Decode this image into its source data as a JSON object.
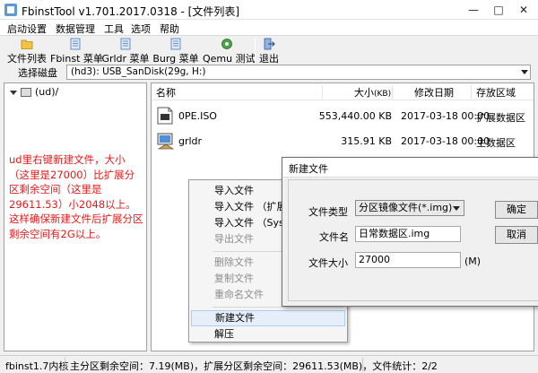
{
  "window": {
    "title": "FbinstTool v1.701.2017.0318 - [文件列表]",
    "minimize": "—",
    "maximize": "□",
    "close": "✕"
  },
  "menubar": [
    "启动设置",
    "数据管理",
    "工具",
    "选项",
    "帮助"
  ],
  "toolbar": [
    {
      "label": "文件列表",
      "icon": "folder-icon"
    },
    {
      "label": "Fbinst 菜单",
      "icon": "menu-doc-icon"
    },
    {
      "label": "Grldr 菜单",
      "icon": "menu-doc-icon"
    },
    {
      "label": "Burg 菜单",
      "icon": "menu-doc-icon"
    },
    {
      "label": "Qemu 测试",
      "icon": "qemu-icon"
    },
    {
      "label": "退出",
      "icon": "exit-icon"
    }
  ],
  "disk": {
    "label": "选择磁盘",
    "value": "(hd3): USB_SanDisk(29g, H:)"
  },
  "tree": {
    "item": "(ud)/"
  },
  "note": "ud里右键新建文件，大小（这里是27000）比扩展分区剩余空间（这里是29611.53）小2048以上。这样确保新建文件后扩展分区剩余空间有2G以上。",
  "list": {
    "headers": {
      "name": "名称",
      "size": "大小",
      "size_unit": "(KB)",
      "date": "修改日期",
      "area": "存放区域"
    },
    "rows": [
      {
        "name": "0PE.ISO",
        "size": "553,440.00 KB",
        "date": "2017-03-18 00:00",
        "area": "扩展数据区",
        "icon": "iso-file-icon"
      },
      {
        "name": "grldr",
        "size": "315.91 KB",
        "date": "2017-03-18 00:00",
        "area": "主数据区",
        "icon": "grldr-file-icon"
      }
    ]
  },
  "context_menu": [
    {
      "label": "导入文件",
      "disabled": false
    },
    {
      "label": "导入文件 （扩展分",
      "disabled": false
    },
    {
      "label": "导入文件 （Syslin",
      "disabled": false
    },
    {
      "label": "导出文件",
      "disabled": true
    },
    {
      "label": "删除文件",
      "disabled": true
    },
    {
      "label": "复制文件",
      "disabled": true
    },
    {
      "label": "重命名文件",
      "disabled": true
    },
    {
      "label": "新建文件",
      "disabled": false,
      "highlighted": true
    },
    {
      "label": "解压",
      "disabled": false
    }
  ],
  "dialog": {
    "title": "新建文件",
    "type_label": "文件类型",
    "type_value": "分区镜像文件(*.img)",
    "name_label": "文件名",
    "name_value": "日常数据区.img",
    "size_label": "文件大小",
    "size_value": "27000",
    "size_unit": "(M)",
    "ok": "确定",
    "cancel": "取消"
  },
  "status": {
    "version": "fbinst1.7内核",
    "main": "主分区剩余空间：7.19(MB)，扩展分区剩余空间：29611.53(MB)，文件统计：2/2"
  },
  "colors": {
    "note_text": "#e8181a",
    "highlight_bg": "#e5eef9"
  }
}
